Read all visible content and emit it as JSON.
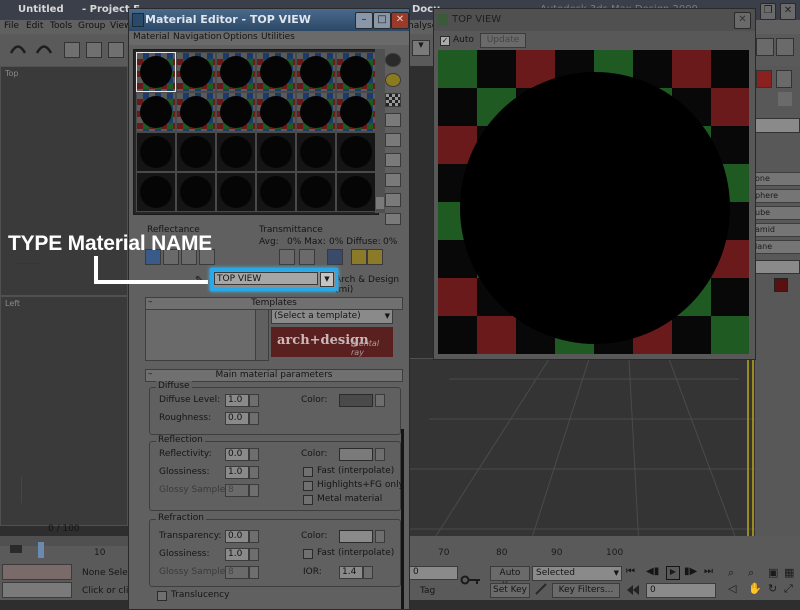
{
  "app": {
    "title": "Untitled",
    "title_rest": "- Project F",
    "title_right": "Docu",
    "title_far": "Autodesk 3ds Max Design 2009",
    "menu": [
      "File",
      "Edit",
      "Tools",
      "Group",
      "View"
    ],
    "menu_far": "nalyse",
    "viewport_top_label": "Top",
    "viewport_left_label": "Left",
    "timeline_counter": "0 / 100",
    "tick_10": "10",
    "ruler_ticks": [
      "70",
      "80",
      "90",
      "100"
    ],
    "status_none_select": "None Selec",
    "status_click": "Click or click",
    "frame_value": "0",
    "auto_key": "Auto Key",
    "set_key": "Set Key",
    "selected_option": "Selected",
    "key_filters": "Key Filters...",
    "frame_field": "0",
    "add_tag": "Tag",
    "cmd_items": [
      "one",
      "phere",
      "ube",
      "amid",
      "lane"
    ]
  },
  "material_editor": {
    "title": "Material Editor - TOP VIEW",
    "menu": [
      "Material",
      "Navigation",
      "Options",
      "Utilities"
    ],
    "reflectance_label": "Reflectance",
    "transmittance_label": "Transmittance",
    "avg_label": "Avg:",
    "max_label": "0% Max:",
    "diffuse_pct": "0% Diffuse:",
    "diffuse_val": "0%",
    "material_name": "TOP VIEW",
    "material_type": "Arch & Design (mi)",
    "templates_header": "Templates",
    "templates_select": "(Select a template)",
    "arch_design_logo": "arch+design",
    "mental_ray_logo": "mental ray",
    "main_params_header": "Main material parameters",
    "diffuse": {
      "group": "Diffuse",
      "level_label": "Diffuse Level:",
      "level": "1.0",
      "roughness_label": "Roughness:",
      "roughness": "0.0",
      "color_label": "Color:"
    },
    "reflection": {
      "group": "Reflection",
      "reflectivity_label": "Reflectivity:",
      "reflectivity": "0.0",
      "glossiness_label": "Glossiness:",
      "glossiness": "1.0",
      "samples_label": "Glossy Samples:",
      "samples": "8",
      "color_label": "Color:",
      "fast_label": "Fast (interpolate)",
      "highlights_label": "Highlights+FG only",
      "metal_label": "Metal material"
    },
    "refraction": {
      "group": "Refraction",
      "transparency_label": "Transparency:",
      "transparency": "0.0",
      "glossiness_label": "Glossiness:",
      "glossiness": "1.0",
      "samples_label": "Glossy Samples:",
      "samples": "8",
      "color_label": "Color:",
      "fast_label": "Fast (interpolate)",
      "ior_label": "IOR:",
      "ior": "1.4"
    },
    "translucency_label": "Translucency"
  },
  "render_window": {
    "title": "TOP VIEW",
    "auto_label": "Auto",
    "update_label": "Update"
  },
  "callout": {
    "text": "TYPE Material NAME"
  },
  "colors": {
    "highlight": "#2aa9e8",
    "checker_red": "#6a1a1a",
    "checker_green": "#1f5a23",
    "checker_blue": "#1c2a7a",
    "checker_gray": "#5a5a5a"
  }
}
